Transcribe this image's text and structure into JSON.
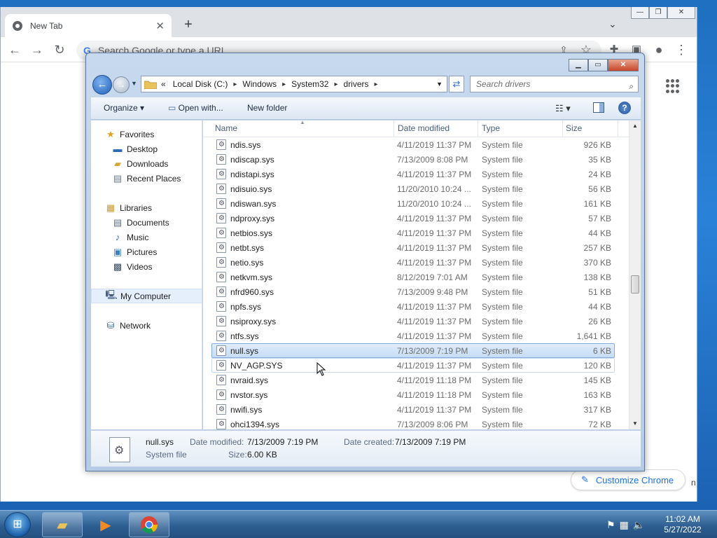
{
  "chrome": {
    "tab_title": "New Tab",
    "tab_close": "✕",
    "new_tab": "+",
    "omnibox_placeholder": "Search Google or type a URL",
    "omnibox_logo": "G",
    "customize_label": "Customize Chrome",
    "customize_icon": "✎",
    "edge_glyph": "n"
  },
  "explorer": {
    "breadcrumb": [
      "Local Disk (C:)",
      "Windows",
      "System32",
      "drivers"
    ],
    "breadcrumb_lead": "«",
    "search_placeholder": "Search drivers",
    "commands": {
      "organize": "Organize ▾",
      "open_with": "Open with...",
      "new_folder": "New folder"
    },
    "columns": {
      "name": "Name",
      "date": "Date modified",
      "type": "Type",
      "size": "Size"
    },
    "nav": {
      "favorites": "Favorites",
      "desktop": "Desktop",
      "downloads": "Downloads",
      "recent": "Recent Places",
      "libraries": "Libraries",
      "documents": "Documents",
      "music": "Music",
      "pictures": "Pictures",
      "videos": "Videos",
      "computer": "My Computer",
      "network": "Network"
    },
    "files": [
      {
        "name": "ndis.sys",
        "date": "4/11/2019 11:37 PM",
        "type": "System file",
        "size": "926 KB"
      },
      {
        "name": "ndiscap.sys",
        "date": "7/13/2009 8:08 PM",
        "type": "System file",
        "size": "35 KB"
      },
      {
        "name": "ndistapi.sys",
        "date": "4/11/2019 11:37 PM",
        "type": "System file",
        "size": "24 KB"
      },
      {
        "name": "ndisuio.sys",
        "date": "11/20/2010 10:24 ...",
        "type": "System file",
        "size": "56 KB"
      },
      {
        "name": "ndiswan.sys",
        "date": "11/20/2010 10:24 ...",
        "type": "System file",
        "size": "161 KB"
      },
      {
        "name": "ndproxy.sys",
        "date": "4/11/2019 11:37 PM",
        "type": "System file",
        "size": "57 KB"
      },
      {
        "name": "netbios.sys",
        "date": "4/11/2019 11:37 PM",
        "type": "System file",
        "size": "44 KB"
      },
      {
        "name": "netbt.sys",
        "date": "4/11/2019 11:37 PM",
        "type": "System file",
        "size": "257 KB"
      },
      {
        "name": "netio.sys",
        "date": "4/11/2019 11:37 PM",
        "type": "System file",
        "size": "370 KB"
      },
      {
        "name": "netkvm.sys",
        "date": "8/12/2019 7:01 AM",
        "type": "System file",
        "size": "138 KB"
      },
      {
        "name": "nfrd960.sys",
        "date": "7/13/2009 9:48 PM",
        "type": "System file",
        "size": "51 KB"
      },
      {
        "name": "npfs.sys",
        "date": "4/11/2019 11:37 PM",
        "type": "System file",
        "size": "44 KB"
      },
      {
        "name": "nsiproxy.sys",
        "date": "4/11/2019 11:37 PM",
        "type": "System file",
        "size": "26 KB"
      },
      {
        "name": "ntfs.sys",
        "date": "4/11/2019 11:37 PM",
        "type": "System file",
        "size": "1,641 KB"
      },
      {
        "name": "null.sys",
        "date": "7/13/2009 7:19 PM",
        "type": "System file",
        "size": "6 KB"
      },
      {
        "name": "NV_AGP.SYS",
        "date": "4/11/2019 11:37 PM",
        "type": "System file",
        "size": "120 KB"
      },
      {
        "name": "nvraid.sys",
        "date": "4/11/2019 11:18 PM",
        "type": "System file",
        "size": "145 KB"
      },
      {
        "name": "nvstor.sys",
        "date": "4/11/2019 11:18 PM",
        "type": "System file",
        "size": "163 KB"
      },
      {
        "name": "nwifi.sys",
        "date": "4/11/2019 11:37 PM",
        "type": "System file",
        "size": "317 KB"
      },
      {
        "name": "ohci1394.sys",
        "date": "7/13/2009 8:06 PM",
        "type": "System file",
        "size": "72 KB"
      }
    ],
    "selected_index": 14,
    "hover_index": 15,
    "details": {
      "name": "null.sys",
      "type": "System file",
      "modified_label": "Date modified:",
      "modified_value": "7/13/2009 7:19 PM",
      "created_label": "Date created:",
      "created_value": "7/13/2009 7:19 PM",
      "size_label": "Size:",
      "size_value": "6.00 KB"
    }
  },
  "taskbar": {
    "time": "11:02 AM",
    "date": "5/27/2022"
  },
  "colors": {
    "selection": "#c6dcf7",
    "accent": "#1a73e8",
    "taskbar": "#2c5c8f"
  }
}
